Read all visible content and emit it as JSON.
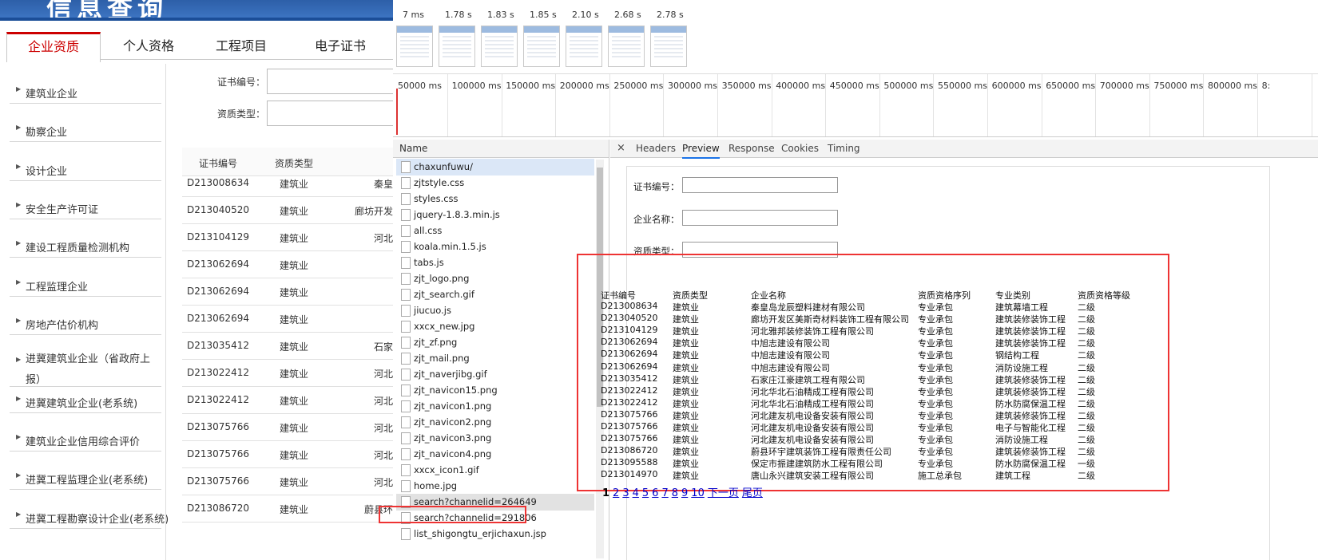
{
  "site": {
    "banner_title": "信息查询",
    "tabs": [
      "企业资质",
      "个人资格",
      "工程项目",
      "电子证书"
    ],
    "sidebar": [
      "建筑业企业",
      "勘察企业",
      "设计企业",
      "安全生产许可证",
      "建设工程质量检测机构",
      "工程监理企业",
      "房地产估价机构",
      "进冀建筑业企业（省政府上报）",
      "进冀建筑业企业(老系统)",
      "建筑业企业信用综合评价",
      "进冀工程监理企业(老系统)",
      "进冀工程勘察设计企业(老系统)"
    ],
    "form": {
      "cert_no_label": "证书编号：",
      "qual_type_label": "资质类型："
    },
    "table_head": [
      "证书编号",
      "资质类型",
      ""
    ],
    "rows": [
      [
        "D213008634",
        "建筑业",
        "秦皇"
      ],
      [
        "D213040520",
        "建筑业",
        "廊坊开发"
      ],
      [
        "D213104129",
        "建筑业",
        "河北"
      ],
      [
        "D213062694",
        "建筑业",
        ""
      ],
      [
        "D213062694",
        "建筑业",
        ""
      ],
      [
        "D213062694",
        "建筑业",
        ""
      ],
      [
        "D213035412",
        "建筑业",
        "石家"
      ],
      [
        "D213022412",
        "建筑业",
        "河北"
      ],
      [
        "D213022412",
        "建筑业",
        "河北"
      ],
      [
        "D213075766",
        "建筑业",
        "河北"
      ],
      [
        "D213075766",
        "建筑业",
        "河北"
      ],
      [
        "D213075766",
        "建筑业",
        "河北"
      ],
      [
        "D213086720",
        "建筑业",
        "蔚县环"
      ]
    ]
  },
  "devtools": {
    "film_times": [
      "7 ms",
      "1.78 s",
      "1.83 s",
      "1.85 s",
      "2.10 s",
      "2.68 s",
      "2.78 s"
    ],
    "ticks": [
      "50000 ms",
      "100000 ms",
      "150000 ms",
      "200000 ms",
      "250000 ms",
      "300000 ms",
      "350000 ms",
      "400000 ms",
      "450000 ms",
      "500000 ms",
      "550000 ms",
      "600000 ms",
      "650000 ms",
      "700000 ms",
      "750000 ms",
      "800000 ms",
      "8:"
    ],
    "name_header": "Name",
    "requests": [
      "chaxunfuwu/",
      "zjtstyle.css",
      "styles.css",
      "jquery-1.8.3.min.js",
      "all.css",
      "koala.min.1.5.js",
      "tabs.js",
      "zjt_logo.png",
      "zjt_search.gif",
      "jiucuo.js",
      "xxcx_new.jpg",
      "zjt_zf.png",
      "zjt_mail.png",
      "zjt_naverjibg.gif",
      "zjt_navicon15.png",
      "zjt_navicon1.png",
      "zjt_navicon2.png",
      "zjt_navicon3.png",
      "zjt_navicon4.png",
      "xxcx_icon1.gif",
      "home.jpg",
      "search?channelid=264649",
      "search?channelid=291806",
      "list_shigongtu_erjichaxun.jsp"
    ],
    "close_glyph": "×",
    "preview_tabs": [
      "Headers",
      "Preview",
      "Response",
      "Cookies",
      "Timing"
    ],
    "preview_labels": [
      "证书编号：",
      "企业名称：",
      "资质类型："
    ],
    "preview_head": [
      "证书编号",
      "资质类型",
      "企业名称",
      "资质资格序列",
      "专业类别",
      "资质资格等级"
    ],
    "preview_rows": [
      [
        "D213008634",
        "建筑业",
        "秦皇岛龙辰塑料建材有限公司",
        "专业承包",
        "建筑幕墙工程",
        "二级"
      ],
      [
        "D213040520",
        "建筑业",
        "廊坊开发区美斯奇材料装饰工程有限公司",
        "专业承包",
        "建筑装修装饰工程",
        "二级"
      ],
      [
        "D213104129",
        "建筑业",
        "河北雅邦装修装饰工程有限公司",
        "专业承包",
        "建筑装修装饰工程",
        "二级"
      ],
      [
        "D213062694",
        "建筑业",
        "中旭志建设有限公司",
        "专业承包",
        "建筑装修装饰工程",
        "二级"
      ],
      [
        "D213062694",
        "建筑业",
        "中旭志建设有限公司",
        "专业承包",
        "钢结构工程",
        "二级"
      ],
      [
        "D213062694",
        "建筑业",
        "中旭志建设有限公司",
        "专业承包",
        "消防设施工程",
        "二级"
      ],
      [
        "D213035412",
        "建筑业",
        "石家庄江豪建筑工程有限公司",
        "专业承包",
        "建筑装修装饰工程",
        "二级"
      ],
      [
        "D213022412",
        "建筑业",
        "河北华北石油精成工程有限公司",
        "专业承包",
        "建筑装修装饰工程",
        "二级"
      ],
      [
        "D213022412",
        "建筑业",
        "河北华北石油精成工程有限公司",
        "专业承包",
        "防水防腐保温工程",
        "二级"
      ],
      [
        "D213075766",
        "建筑业",
        "河北建友机电设备安装有限公司",
        "专业承包",
        "建筑装修装饰工程",
        "二级"
      ],
      [
        "D213075766",
        "建筑业",
        "河北建友机电设备安装有限公司",
        "专业承包",
        "电子与智能化工程",
        "二级"
      ],
      [
        "D213075766",
        "建筑业",
        "河北建友机电设备安装有限公司",
        "专业承包",
        "消防设施工程",
        "二级"
      ],
      [
        "D213086720",
        "建筑业",
        "蔚县环宇建筑装饰工程有限责任公司",
        "专业承包",
        "建筑装修装饰工程",
        "二级"
      ],
      [
        "D213095588",
        "建筑业",
        "保定市振建建筑防水工程有限公司",
        "专业承包",
        "防水防腐保温工程",
        "一级"
      ],
      [
        "D213014970",
        "建筑业",
        "唐山永兴建筑安装工程有限公司",
        "施工总承包",
        "建筑工程",
        "二级"
      ]
    ],
    "pager": [
      "1",
      "2",
      "3",
      "4",
      "5",
      "6",
      "7",
      "8",
      "9",
      "10",
      "下一页",
      "尾页"
    ]
  },
  "colors": {
    "accent_red": "#e33333",
    "link_blue": "#0000cc",
    "tab_active": "#1a73e8"
  }
}
